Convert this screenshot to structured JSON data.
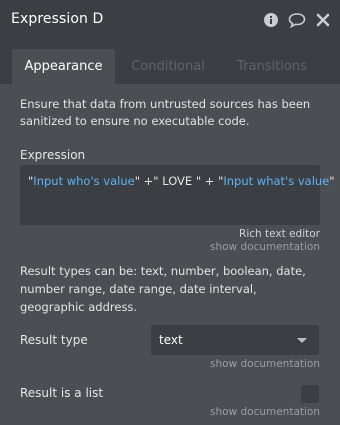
{
  "panel": {
    "title": "Expression D",
    "icons": [
      "info-icon",
      "comment-icon",
      "close-icon"
    ]
  },
  "tabs": [
    {
      "label": "Appearance"
    },
    {
      "label": "Conditional"
    },
    {
      "label": "Transitions"
    }
  ],
  "warning_text": "Ensure that data from untrusted sources has been sanitized to ensure no executable code.",
  "expression": {
    "label": "Expression",
    "parts": {
      "q1": "\"",
      "dyn1": "Input who's value",
      "mid": "\" +\" LOVE \" + \"",
      "dyn2": "Input what's value",
      "q2": "\""
    },
    "rich_text_editor": "Rich text editor",
    "show_documentation": "show documentation"
  },
  "result_types_text": "Result types can be: text, number, boolean, date, number range, date range, date interval, geographic address.",
  "result_type": {
    "label": "Result type",
    "value": "text",
    "show_documentation": "show documentation"
  },
  "result_is_list": {
    "label": "Result is a list",
    "show_documentation": "show documentation"
  }
}
